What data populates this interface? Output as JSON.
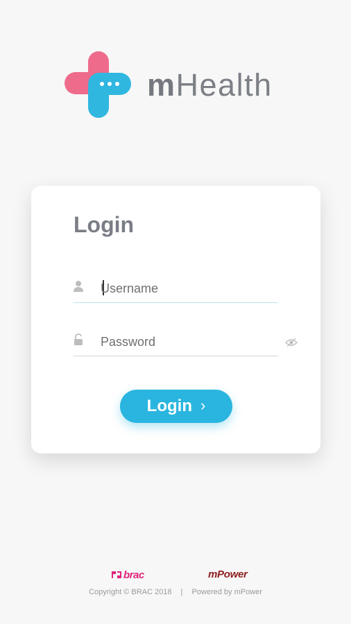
{
  "app": {
    "brand_prefix": "m",
    "brand_name": "Health"
  },
  "login_card": {
    "title": "Login",
    "username_placeholder": "Username",
    "password_placeholder": "Password",
    "submit_label": "Login",
    "submit_chevron": "›"
  },
  "footer": {
    "brac_logo_text": "brac",
    "mpower_logo_text": "mPower",
    "copyright": "Copyright © BRAC 2018",
    "separator": "|",
    "powered_by": "Powered by mPower"
  },
  "icons": {
    "logo": "medical-cross-chat-icon",
    "username": "user-icon",
    "password": "lock-icon",
    "toggle_visibility": "eye-icon",
    "submit": "chevron-right-icon"
  },
  "colors": {
    "background": "#f7f7f7",
    "brand_pink": "#ee6b8c",
    "brand_blue": "#2fb7e0",
    "button": "#29b5df",
    "heading_gray": "#7a7d85",
    "brac_pink": "#e0237b",
    "mpower_red": "#8d1e1e"
  }
}
